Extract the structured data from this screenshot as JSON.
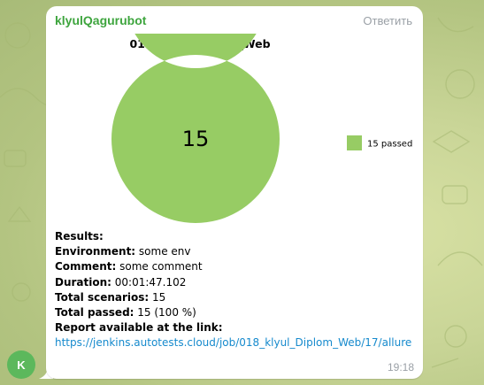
{
  "message": {
    "sender": "klyulQagurubot",
    "reply_label": "Ответить",
    "time": "19:18",
    "avatar_letter": "K"
  },
  "chart_data": {
    "type": "pie",
    "title": "018_klyul_Diplom_Web",
    "center_label": "15",
    "slices": [
      {
        "label": "15 passed",
        "value": 15,
        "color": "#97cc64"
      }
    ],
    "legend_position": "right"
  },
  "report": {
    "results_label": "Results:",
    "environment_label": "Environment:",
    "environment_value": " some env",
    "comment_label": "Comment:",
    "comment_value": " some comment",
    "duration_label": "Duration:",
    "duration_value": " 00:01:47.102",
    "total_scenarios_label": "Total scenarios:",
    "total_scenarios_value": " 15",
    "total_passed_label": "Total passed:",
    "total_passed_value": " 15 (100 %)",
    "link_label": "Report available at the link:",
    "link_url": "https://jenkins.autotests.cloud/job/018_klyul_Diplom_Web/17/allure"
  },
  "colors": {
    "sender": "#3ea53e",
    "link": "#168acd",
    "avatar": "#5cb85c",
    "passed": "#97cc64"
  }
}
